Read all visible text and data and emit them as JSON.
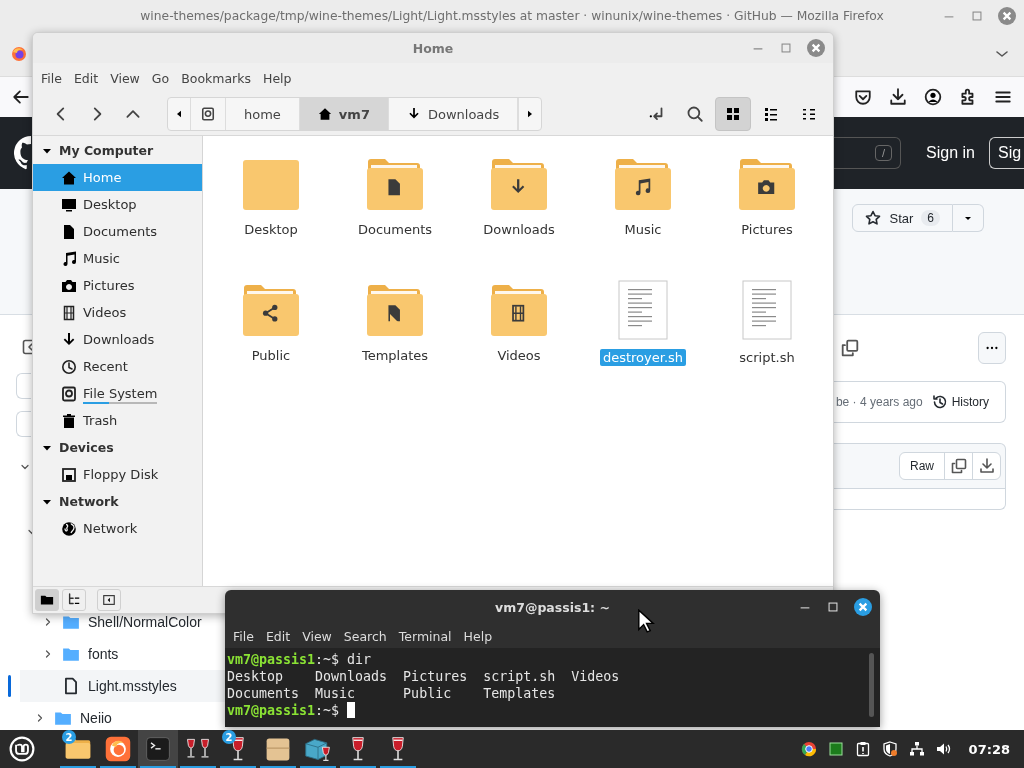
{
  "browser": {
    "title": "wine-themes/package/tmp/wine-themes/Light/Light.msstyles at master · winunix/wine-themes · GitHub — Mozilla Firefox"
  },
  "github": {
    "search_key": "/",
    "sign_in": "Sign in",
    "sign_up": "Sig",
    "star": {
      "label": "Star",
      "count": "6"
    },
    "commit_info": "be · 4 years ago",
    "history": "History",
    "raw": "Raw",
    "tree": [
      {
        "kind": "group",
        "children": [
          {
            "name": "Shell/NormalColor",
            "kind": "folder",
            "selected": false
          },
          {
            "name": "fonts",
            "kind": "folder",
            "selected": false
          },
          {
            "name": "Light.msstyles",
            "kind": "file",
            "selected": true
          }
        ]
      },
      {
        "name": "Neiio",
        "kind": "folder",
        "selected": false
      }
    ]
  },
  "file_manager": {
    "title": "Home",
    "menu": [
      "File",
      "Edit",
      "View",
      "Go",
      "Bookmarks",
      "Help"
    ],
    "path": [
      {
        "kind": "root",
        "selected": false
      },
      {
        "label": "home",
        "kind": "folder",
        "selected": false
      },
      {
        "label": "vm7",
        "kind": "home",
        "selected": true
      },
      {
        "label": "Downloads",
        "kind": "downloads",
        "selected": false
      }
    ],
    "views": [
      {
        "kind": "icons",
        "selected": true
      },
      {
        "kind": "list",
        "selected": false
      },
      {
        "kind": "compact",
        "selected": false
      }
    ],
    "sidebar": [
      {
        "title": "My Computer",
        "expanded": true,
        "items": [
          {
            "label": "Home",
            "kind": "home",
            "selected": true
          },
          {
            "label": "Desktop",
            "kind": "desktop",
            "selected": false
          },
          {
            "label": "Documents",
            "kind": "documents",
            "selected": false
          },
          {
            "label": "Music",
            "kind": "music",
            "selected": false
          },
          {
            "label": "Pictures",
            "kind": "pictures",
            "selected": false
          },
          {
            "label": "Videos",
            "kind": "videos",
            "selected": false
          },
          {
            "label": "Downloads",
            "kind": "downloads",
            "selected": false
          },
          {
            "label": "Recent",
            "kind": "recent",
            "selected": false
          },
          {
            "label": "File System",
            "kind": "filesystem",
            "selected": false,
            "level": 0.35
          },
          {
            "label": "Trash",
            "kind": "trash",
            "selected": false
          }
        ]
      },
      {
        "title": "Devices",
        "expanded": true,
        "items": [
          {
            "label": "Floppy Disk",
            "kind": "floppy",
            "selected": false
          }
        ]
      },
      {
        "title": "Network",
        "expanded": true,
        "items": [
          {
            "label": "Network",
            "kind": "network",
            "selected": false
          }
        ]
      }
    ],
    "files": [
      {
        "name": "Desktop",
        "kind": "desktop",
        "selected": false
      },
      {
        "name": "Documents",
        "kind": "documents",
        "selected": false
      },
      {
        "name": "Downloads",
        "kind": "downloads",
        "selected": false
      },
      {
        "name": "Music",
        "kind": "music",
        "selected": false
      },
      {
        "name": "Pictures",
        "kind": "pictures",
        "selected": false
      },
      {
        "name": "Public",
        "kind": "public",
        "selected": false
      },
      {
        "name": "Templates",
        "kind": "templates",
        "selected": false
      },
      {
        "name": "Videos",
        "kind": "videos",
        "selected": false
      },
      {
        "name": "destroyer.sh",
        "kind": "script",
        "selected": true
      },
      {
        "name": "script.sh",
        "kind": "script",
        "selected": false
      }
    ],
    "panes": [
      {
        "kind": "places",
        "selected": true
      },
      {
        "kind": "tree",
        "selected": false
      },
      {
        "kind": "toggle",
        "selected": false
      }
    ]
  },
  "terminal": {
    "title": "vm7@passis1: ~",
    "menu": [
      "File",
      "Edit",
      "View",
      "Search",
      "Terminal",
      "Help"
    ],
    "lines": [
      {
        "kind": "prompt",
        "user": "vm7@passis1",
        "path": ":~$",
        "text": "dir"
      },
      {
        "kind": "output",
        "text": "Desktop    Downloads  Pictures  script.sh  Videos"
      },
      {
        "kind": "output",
        "text": "Documents  Music      Public    Templates"
      },
      {
        "kind": "prompt",
        "user": "vm7@passis1",
        "path": ":~$",
        "cursor": true
      }
    ]
  },
  "taskbar": {
    "apps": [
      {
        "kind": "files",
        "badge": "2",
        "active": false,
        "running": true
      },
      {
        "kind": "browser",
        "active": false,
        "running": true
      },
      {
        "kind": "terminal",
        "active": true,
        "running": true
      },
      {
        "kind": "wineglasses",
        "active": false,
        "running": true
      },
      {
        "kind": "wineglass",
        "badge": "2",
        "active": false,
        "running": true
      },
      {
        "kind": "package",
        "active": false,
        "running": true
      },
      {
        "kind": "winecabinet",
        "active": false,
        "running": true
      },
      {
        "kind": "wineglass",
        "active": false,
        "running": true
      },
      {
        "kind": "wineglass",
        "active": false,
        "running": true
      }
    ],
    "clock": "07:28"
  }
}
